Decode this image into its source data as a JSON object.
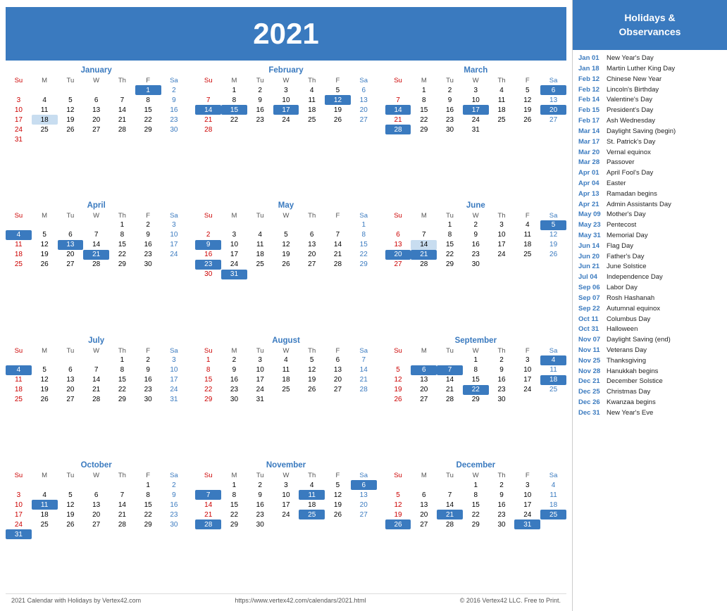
{
  "header": {
    "year": "2021"
  },
  "footer": {
    "left": "2021 Calendar with Holidays by Vertex42.com",
    "center": "https://www.vertex42.com/calendars/2021.html",
    "right": "© 2016 Vertex42 LLC. Free to Print."
  },
  "holidays_header": "Holidays &\nObservances",
  "holidays": [
    {
      "date": "Jan 01",
      "name": "New Year's Day"
    },
    {
      "date": "Jan 18",
      "name": "Martin Luther King Day"
    },
    {
      "date": "Feb 12",
      "name": "Chinese New Year"
    },
    {
      "date": "Feb 12",
      "name": "Lincoln's Birthday"
    },
    {
      "date": "Feb 14",
      "name": "Valentine's Day"
    },
    {
      "date": "Feb 15",
      "name": "President's Day"
    },
    {
      "date": "Feb 17",
      "name": "Ash Wednesday"
    },
    {
      "date": "Mar 14",
      "name": "Daylight Saving (begin)"
    },
    {
      "date": "Mar 17",
      "name": "St. Patrick's Day"
    },
    {
      "date": "Mar 20",
      "name": "Vernal equinox"
    },
    {
      "date": "Mar 28",
      "name": "Passover"
    },
    {
      "date": "Apr 01",
      "name": "April Fool's Day"
    },
    {
      "date": "Apr 04",
      "name": "Easter"
    },
    {
      "date": "Apr 13",
      "name": "Ramadan begins"
    },
    {
      "date": "Apr 21",
      "name": "Admin Assistants Day"
    },
    {
      "date": "May 09",
      "name": "Mother's Day"
    },
    {
      "date": "May 23",
      "name": "Pentecost"
    },
    {
      "date": "May 31",
      "name": "Memorial Day"
    },
    {
      "date": "Jun 14",
      "name": "Flag Day"
    },
    {
      "date": "Jun 20",
      "name": "Father's Day"
    },
    {
      "date": "Jun 21",
      "name": "June Solstice"
    },
    {
      "date": "Jul 04",
      "name": "Independence Day"
    },
    {
      "date": "Sep 06",
      "name": "Labor Day"
    },
    {
      "date": "Sep 07",
      "name": "Rosh Hashanah"
    },
    {
      "date": "Sep 22",
      "name": "Autumnal equinox"
    },
    {
      "date": "Oct 11",
      "name": "Columbus Day"
    },
    {
      "date": "Oct 31",
      "name": "Halloween"
    },
    {
      "date": "Nov 07",
      "name": "Daylight Saving (end)"
    },
    {
      "date": "Nov 11",
      "name": "Veterans Day"
    },
    {
      "date": "Nov 25",
      "name": "Thanksgiving"
    },
    {
      "date": "Nov 28",
      "name": "Hanukkah begins"
    },
    {
      "date": "Dec 21",
      "name": "December Solstice"
    },
    {
      "date": "Dec 25",
      "name": "Christmas Day"
    },
    {
      "date": "Dec 26",
      "name": "Kwanzaa begins"
    },
    {
      "date": "Dec 31",
      "name": "New Year's Eve"
    }
  ],
  "months": [
    {
      "name": "January",
      "days_header": [
        "Su",
        "M",
        "Tu",
        "W",
        "Th",
        "F",
        "Sa"
      ],
      "weeks": [
        [
          null,
          null,
          null,
          null,
          null,
          "1h",
          "2"
        ],
        [
          "3",
          "4",
          "5",
          "6",
          "7",
          "8",
          "9"
        ],
        [
          "10",
          "11",
          "12",
          "13",
          "14",
          "15",
          "16"
        ],
        [
          "17",
          "18h",
          "19",
          "20",
          "21",
          "22",
          "23"
        ],
        [
          "24",
          "25",
          "26",
          "27",
          "28",
          "29",
          "30"
        ],
        [
          "31",
          null,
          null,
          null,
          null,
          null,
          null
        ]
      ]
    },
    {
      "name": "February",
      "days_header": [
        "Su",
        "M",
        "Tu",
        "W",
        "Th",
        "F",
        "Sa"
      ],
      "weeks": [
        [
          null,
          "1",
          "2",
          "3",
          "4",
          "5",
          "6"
        ],
        [
          "7",
          "8",
          "9",
          "10",
          "11",
          "12h",
          "13"
        ],
        [
          "14h",
          "15h",
          "16",
          "17h",
          "18",
          "19",
          "20"
        ],
        [
          "21",
          "22",
          "23",
          "24",
          "25",
          "26",
          "27"
        ],
        [
          "28",
          null,
          null,
          null,
          null,
          null,
          null
        ]
      ]
    },
    {
      "name": "March",
      "days_header": [
        "Su",
        "M",
        "Tu",
        "W",
        "Th",
        "F",
        "Sa"
      ],
      "weeks": [
        [
          null,
          "1",
          "2",
          "3",
          "4",
          "5",
          "6h"
        ],
        [
          "7",
          "8",
          "9",
          "10",
          "11",
          "12",
          "13"
        ],
        [
          "14h",
          "15",
          "16",
          "17h",
          "18",
          "19",
          "20h"
        ],
        [
          "21",
          "22",
          "23",
          "24",
          "25",
          "26",
          "27"
        ],
        [
          "28h",
          "29",
          "30",
          "31",
          null,
          null,
          null
        ]
      ]
    },
    {
      "name": "April",
      "days_header": [
        "Su",
        "M",
        "Tu",
        "W",
        "Th",
        "F",
        "Sa"
      ],
      "weeks": [
        [
          null,
          null,
          null,
          null,
          "1",
          "2",
          "3"
        ],
        [
          "4h",
          "5",
          "6",
          "7",
          "8",
          "9",
          "10"
        ],
        [
          "11",
          "12",
          "13h",
          "14",
          "15",
          "16",
          "17"
        ],
        [
          "18",
          "19",
          "20",
          "21h",
          "22",
          "23",
          "24"
        ],
        [
          "25",
          "26",
          "27",
          "28",
          "29",
          "30",
          null
        ]
      ]
    },
    {
      "name": "May",
      "days_header": [
        "Su",
        "M",
        "Tu",
        "W",
        "Th",
        "F",
        "Sa"
      ],
      "weeks": [
        [
          null,
          null,
          null,
          null,
          null,
          null,
          "1"
        ],
        [
          "2",
          "3",
          "4",
          "5",
          "6",
          "7",
          "8"
        ],
        [
          "9h",
          "10",
          "11",
          "12",
          "13",
          "14",
          "15"
        ],
        [
          "16",
          "17",
          "18",
          "19",
          "20",
          "21",
          "22"
        ],
        [
          "23h",
          "24",
          "25",
          "26",
          "27",
          "28",
          "29"
        ],
        [
          "30",
          "31h",
          null,
          null,
          null,
          null,
          null
        ]
      ]
    },
    {
      "name": "June",
      "days_header": [
        "Su",
        "M",
        "Tu",
        "W",
        "Th",
        "F",
        "Sa"
      ],
      "weeks": [
        [
          null,
          null,
          "1",
          "2",
          "3",
          "4",
          "5h"
        ],
        [
          "6",
          "7",
          "8",
          "9",
          "10",
          "11",
          "12"
        ],
        [
          "13",
          "14h",
          "15",
          "16",
          "17",
          "18",
          "19"
        ],
        [
          "20h",
          "21h",
          "22",
          "23",
          "24",
          "25",
          "26"
        ],
        [
          "27",
          "28",
          "29",
          "30",
          null,
          null,
          null
        ]
      ]
    },
    {
      "name": "July",
      "days_header": [
        "Su",
        "M",
        "Tu",
        "W",
        "Th",
        "F",
        "Sa"
      ],
      "weeks": [
        [
          null,
          null,
          null,
          null,
          "1",
          "2",
          "3"
        ],
        [
          "4h",
          "5",
          "6",
          "7",
          "8",
          "9",
          "10"
        ],
        [
          "11",
          "12",
          "13",
          "14",
          "15",
          "16",
          "17"
        ],
        [
          "18",
          "19",
          "20",
          "21",
          "22",
          "23",
          "24"
        ],
        [
          "25",
          "26",
          "27",
          "28",
          "29",
          "30",
          "31"
        ]
      ]
    },
    {
      "name": "August",
      "days_header": [
        "Su",
        "M",
        "Tu",
        "W",
        "Th",
        "F",
        "Sa"
      ],
      "weeks": [
        [
          "1",
          "2",
          "3",
          "4",
          "5",
          "6",
          "7"
        ],
        [
          "8",
          "9",
          "10",
          "11",
          "12",
          "13",
          "14"
        ],
        [
          "15",
          "16",
          "17",
          "18",
          "19",
          "20",
          "21"
        ],
        [
          "22",
          "23",
          "24",
          "25",
          "26",
          "27",
          "28"
        ],
        [
          "29",
          "30",
          "31",
          null,
          null,
          null,
          null
        ]
      ]
    },
    {
      "name": "September",
      "days_header": [
        "Su",
        "M",
        "Tu",
        "W",
        "Th",
        "F",
        "Sa"
      ],
      "weeks": [
        [
          null,
          null,
          null,
          "1",
          "2",
          "3",
          "4h"
        ],
        [
          "5",
          "6h",
          "7h",
          "8",
          "9",
          "10",
          "11"
        ],
        [
          "12",
          "13",
          "14",
          "15",
          "16",
          "17",
          "18h"
        ],
        [
          "19",
          "20",
          "21",
          "22h",
          "23",
          "24",
          "25"
        ],
        [
          "26",
          "27",
          "28",
          "29",
          "30",
          null,
          null
        ]
      ]
    },
    {
      "name": "October",
      "days_header": [
        "Su",
        "M",
        "Tu",
        "W",
        "Th",
        "F",
        "Sa"
      ],
      "weeks": [
        [
          null,
          null,
          null,
          null,
          null,
          "1",
          "2"
        ],
        [
          "3",
          "4",
          "5",
          "6",
          "7",
          "8",
          "9"
        ],
        [
          "10",
          "11h",
          "12",
          "13",
          "14",
          "15",
          "16"
        ],
        [
          "17",
          "18",
          "19",
          "20",
          "21",
          "22",
          "23"
        ],
        [
          "24",
          "25",
          "26",
          "27",
          "28",
          "29",
          "30"
        ],
        [
          "31h",
          null,
          null,
          null,
          null,
          null,
          null
        ]
      ]
    },
    {
      "name": "November",
      "days_header": [
        "Su",
        "M",
        "Tu",
        "W",
        "Th",
        "F",
        "Sa"
      ],
      "weeks": [
        [
          null,
          "1",
          "2",
          "3",
          "4",
          "5",
          "6h"
        ],
        [
          "7h",
          "8",
          "9",
          "10",
          "11h",
          "12",
          "13"
        ],
        [
          "14",
          "15",
          "16",
          "17",
          "18",
          "19",
          "20"
        ],
        [
          "21",
          "22",
          "23",
          "24",
          "25h",
          "26",
          "27"
        ],
        [
          "28h",
          "29",
          "30",
          null,
          null,
          null,
          null
        ]
      ]
    },
    {
      "name": "December",
      "days_header": [
        "Su",
        "M",
        "Tu",
        "W",
        "Th",
        "F",
        "Sa"
      ],
      "weeks": [
        [
          null,
          null,
          null,
          "1",
          "2",
          "3",
          "4"
        ],
        [
          "5",
          "6",
          "7",
          "8",
          "9",
          "10",
          "11"
        ],
        [
          "12",
          "13",
          "14",
          "15",
          "16",
          "17",
          "18"
        ],
        [
          "19",
          "20",
          "21h",
          "22",
          "23",
          "24",
          "25h"
        ],
        [
          "26h",
          "27",
          "28",
          "29",
          "30",
          "31h",
          null
        ]
      ]
    }
  ]
}
